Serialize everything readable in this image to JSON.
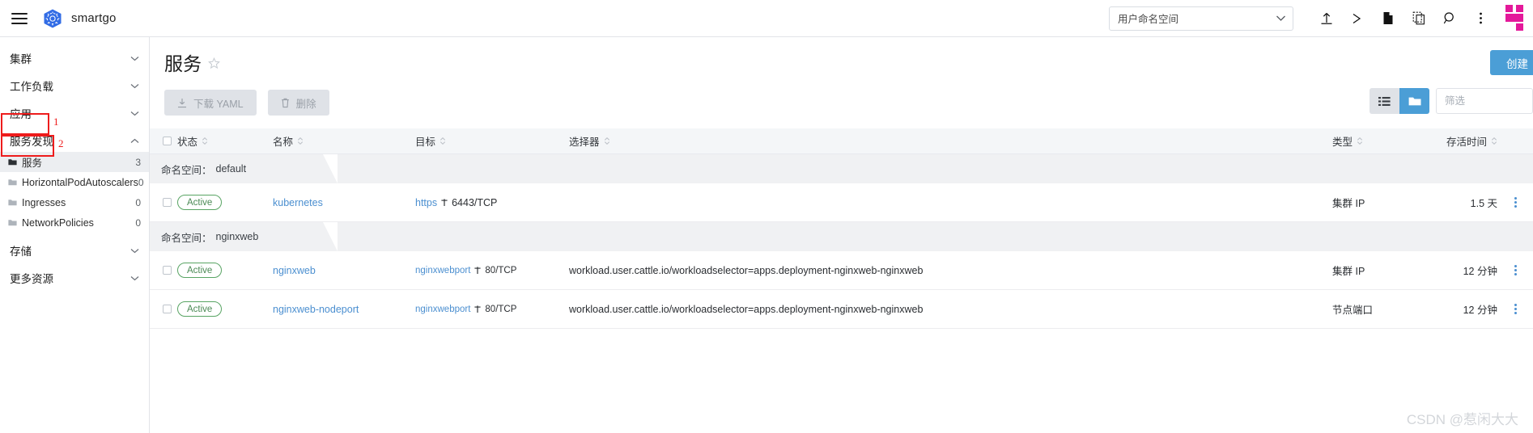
{
  "topbar": {
    "brand": "smartgo",
    "namespace_selector": {
      "value": "用户命名空间",
      "chevron": "chevron-down-icon"
    },
    "icons": [
      "upload-icon",
      "shell-icon",
      "document-icon",
      "copy-icon",
      "search-icon",
      "more-vertical-icon"
    ]
  },
  "sidebar": {
    "groups": [
      {
        "label": "集群",
        "caret": "chevron-down-icon"
      },
      {
        "label": "工作负载",
        "caret": "chevron-down-icon"
      },
      {
        "label": "应用",
        "caret": "chevron-down-icon"
      },
      {
        "label": "服务发现",
        "caret": "chevron-up-icon",
        "annotation": "1"
      },
      {
        "label": "存储",
        "caret": "chevron-down-icon"
      },
      {
        "label": "更多资源",
        "caret": "chevron-down-icon"
      }
    ],
    "items": [
      {
        "label": "服务",
        "count": "3",
        "active": true,
        "annotation": "2"
      },
      {
        "label": "HorizontalPodAutoscalers",
        "count": "0",
        "active": false
      },
      {
        "label": "Ingresses",
        "count": "0",
        "active": false
      },
      {
        "label": "NetworkPolicies",
        "count": "0",
        "active": false
      }
    ]
  },
  "page": {
    "title": "服务",
    "star": "star-outline-icon",
    "create_button": "创建",
    "download_yaml": "下载 YAML",
    "delete": "删除",
    "filter_placeholder": "筛选",
    "view_list": "list-view-icon",
    "view_group": "group-view-icon"
  },
  "table": {
    "headers": {
      "status": "状态",
      "name": "名称",
      "target": "目标",
      "selector": "选择器",
      "type": "类型",
      "age": "存活时间"
    },
    "groups": [
      {
        "label": "命名空间：",
        "namespace": "default",
        "rows": [
          {
            "status": "Active",
            "name": "kubernetes",
            "target_link": "https",
            "target_port": "6443/TCP",
            "selector": "",
            "type": "集群 IP",
            "age": "1.5 天"
          }
        ]
      },
      {
        "label": "命名空间：",
        "namespace": "nginxweb",
        "rows": [
          {
            "status": "Active",
            "name": "nginxweb",
            "target_link": "nginxwebport",
            "target_port": "80/TCP",
            "selector": "workload.user.cattle.io/workloadselector=apps.deployment-nginxweb-nginxweb",
            "type": "集群 IP",
            "age": "12 分钟"
          },
          {
            "status": "Active",
            "name": "nginxweb-nodeport",
            "target_link": "nginxwebport",
            "target_port": "80/TCP",
            "selector": "workload.user.cattle.io/workloadselector=apps.deployment-nginxweb-nginxweb",
            "type": "节点端口",
            "age": "12 分钟"
          }
        ]
      }
    ]
  },
  "watermark": "CSDN @惹闲大大",
  "colors": {
    "accent": "#4b9ed6",
    "link": "#4b8fd0",
    "active_green": "#58a463",
    "annotation_red": "#ee1c1c",
    "brand_pink": "#e4199a"
  }
}
